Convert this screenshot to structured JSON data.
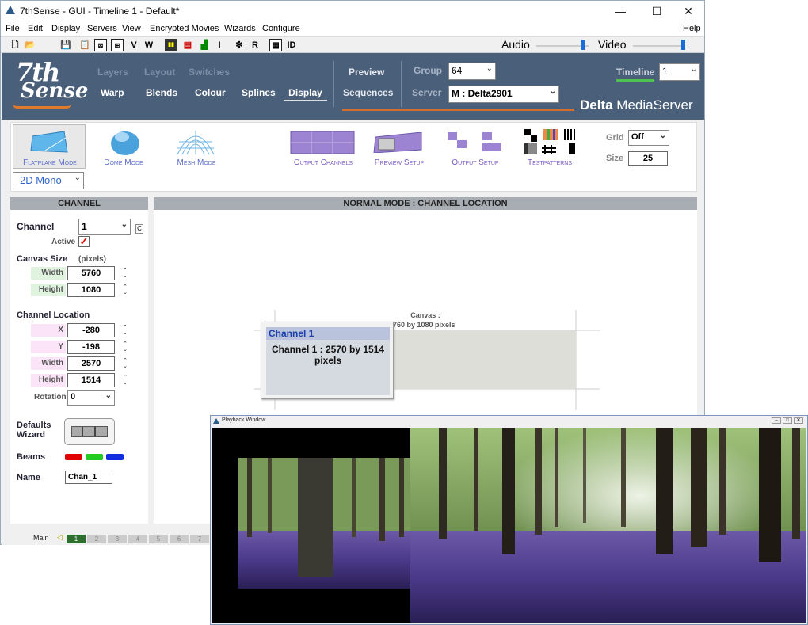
{
  "window": {
    "app_name": "7thSense -",
    "title_rest": "GUI - Timeline 1 - Default*",
    "minimize": "—",
    "maximize": "☐",
    "close": "✕"
  },
  "menu": {
    "items": [
      "File",
      "Edit",
      "Display",
      "Servers",
      "View",
      "Encrypted Movies",
      "Wizards",
      "Configure"
    ],
    "help": "Help"
  },
  "toolbar": {
    "glyphs": [
      "V",
      "W",
      "I",
      "R",
      "ID"
    ],
    "audio_label": "Audio",
    "audio_level": 0.9,
    "video_label": "Video",
    "video_level": 0.95
  },
  "header": {
    "logo_line1": "7th",
    "logo_line2": "Sense",
    "nav_top": [
      "Layers",
      "Layout",
      "Switches"
    ],
    "nav_bottom": [
      "Warp",
      "Blends",
      "Colour",
      "Splines",
      "Display"
    ],
    "nav_selected": "Display",
    "preview": "Preview",
    "sequences": "Sequences",
    "group_label": "Group",
    "group_value": "64",
    "server_label": "Server",
    "server_value": "M : Delta2901",
    "timeline_label": "Timeline",
    "timeline_value": "1",
    "brand_bold": "Delta",
    "brand_rest": " MediaServer"
  },
  "modes": {
    "flatplane": "Flatplane Mode",
    "dome": "Dome Mode",
    "mesh": "Mesh Mode",
    "output_channels": "Output Channels",
    "preview_setup": "Preview Setup",
    "output_setup": "Output Setup",
    "testpatterns": "Testpatterns",
    "stereo_mode": "2D Mono",
    "grid_label": "Grid",
    "grid_value": "Off",
    "size_label": "Size",
    "size_value": "25"
  },
  "channel_panel": {
    "header": "CHANNEL",
    "channel_label": "Channel",
    "channel_value": "1",
    "c_button": "C",
    "active_label": "Active",
    "active_check": "✓",
    "canvas_size_label": "Canvas Size",
    "canvas_size_unit": "(pixels)",
    "width_label": "Width",
    "width_value": "5760",
    "height_label": "Height",
    "height_value": "1080",
    "location_label": "Channel Location",
    "x_label": "X",
    "x_value": "-280",
    "y_label": "Y",
    "y_value": "-198",
    "loc_width_label": "Width",
    "loc_width_value": "2570",
    "loc_height_label": "Height",
    "loc_height_value": "1514",
    "rotation_label": "Rotation",
    "rotation_value": "0",
    "defaults_label_1": "Defaults",
    "defaults_label_2": "Wizard",
    "beams_label": "Beams",
    "beam_colors": [
      "#e00000",
      "#22cc22",
      "#1030e0"
    ],
    "name_label": "Name",
    "name_value": "Chan_1"
  },
  "main_panel": {
    "header": "NORMAL MODE : CHANNEL LOCATION",
    "canvas_label": "Canvas :",
    "canvas_dims": "5760 by 1080 pixels",
    "tooltip_title": "Channel 1",
    "tooltip_body": "Channel 1 : 2570 by 1514 pixels"
  },
  "statusbar": {
    "main_label": "Main",
    "arrow": "◁",
    "pages": [
      "1",
      "2",
      "3",
      "4",
      "5",
      "6",
      "7"
    ],
    "active_page": "1"
  },
  "playback": {
    "title": "Playback Window",
    "buttons": [
      "–",
      "□",
      "✕"
    ]
  }
}
